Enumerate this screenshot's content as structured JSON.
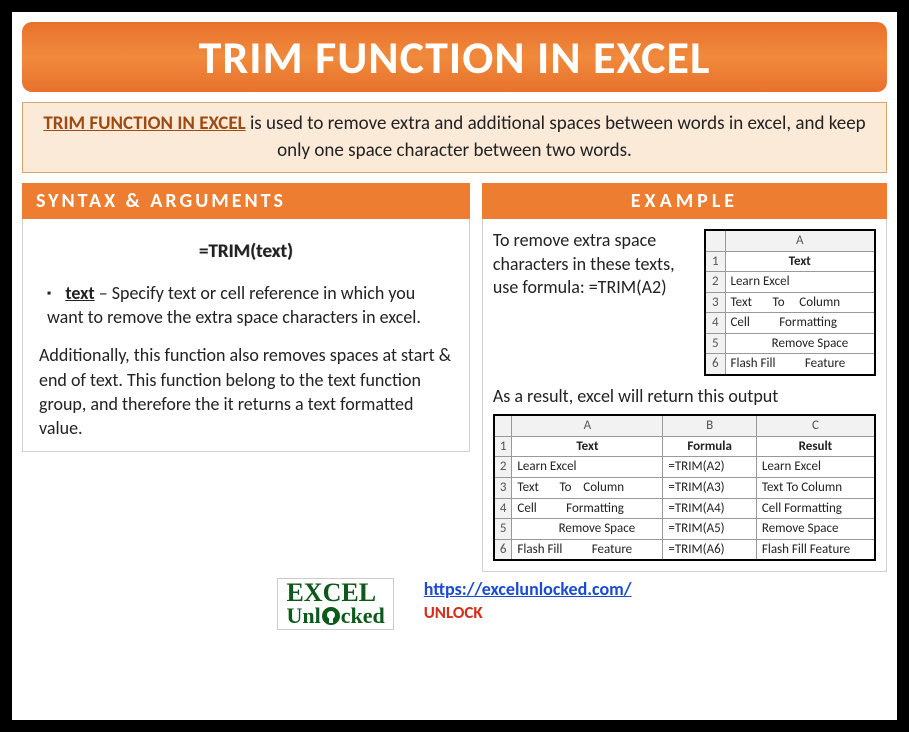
{
  "title": "TRIM FUNCTION IN EXCEL",
  "intro": {
    "lead": "TRIM FUNCTION IN EXCEL",
    "rest": " is used to remove extra and additional spaces between words in excel, and keep only one space character between two words."
  },
  "syntax": {
    "heading": "SYNTAX & ARGUMENTS",
    "formula": "=TRIM(text)",
    "arg_name": "text",
    "arg_desc": " – Specify text or cell reference in which you want to remove the extra space characters in excel.",
    "additional": "Additionally, this function also removes spaces at start & end of text. This function belong to the text function group, and therefore the it returns a text formatted value."
  },
  "example": {
    "heading": "EXAMPLE",
    "intro": "To remove extra space characters in these texts, use formula: =TRIM(A2)",
    "table1": {
      "col_header": "A",
      "rows": [
        {
          "n": "1",
          "a": "Text",
          "hdr": true
        },
        {
          "n": "2",
          "a": "Learn Excel"
        },
        {
          "n": "3",
          "a": "Text       To     Column"
        },
        {
          "n": "4",
          "a": "Cell          Formatting"
        },
        {
          "n": "5",
          "a": "              Remove Space"
        },
        {
          "n": "6",
          "a": "Flash Fill          Feature"
        }
      ]
    },
    "result_line": "As a result, excel will return this output",
    "table2": {
      "col_headers": [
        "A",
        "B",
        "C"
      ],
      "rows": [
        {
          "n": "1",
          "a": "Text",
          "b": "Formula",
          "c": "Result",
          "hdr": true
        },
        {
          "n": "2",
          "a": "Learn Excel",
          "b": "=TRIM(A2)",
          "c": "Learn Excel"
        },
        {
          "n": "3",
          "a": "Text       To    Column",
          "b": "=TRIM(A3)",
          "c": "Text To Column"
        },
        {
          "n": "4",
          "a": "Cell          Formatting",
          "b": "=TRIM(A4)",
          "c": "Cell Formatting"
        },
        {
          "n": "5",
          "a": "              Remove Space",
          "b": "=TRIM(A5)",
          "c": "Remove Space"
        },
        {
          "n": "6",
          "a": "Flash Fill          Feature",
          "b": "=TRIM(A6)",
          "c": "Flash Fill Feature"
        }
      ]
    }
  },
  "footer": {
    "logo_line1": "EXCEL",
    "logo_line2_a": "Unl",
    "logo_line2_b": "cked",
    "url": "https://excelunlocked.com/",
    "unlock": "UNLOCK"
  }
}
